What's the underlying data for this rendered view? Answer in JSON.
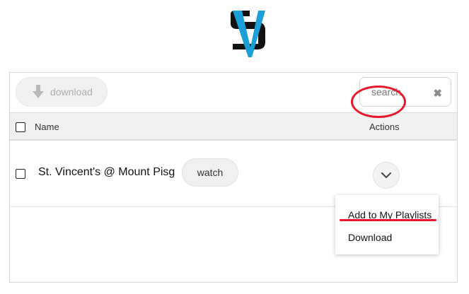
{
  "toolbar": {
    "download_label": "download",
    "search_placeholder": "search"
  },
  "table": {
    "headers": {
      "name": "Name",
      "actions": "Actions"
    },
    "rows": [
      {
        "name": "St. Vincent's @ Mount Pisg",
        "watch_label": "watch"
      }
    ]
  },
  "action_menu": {
    "items": [
      "Add to My Playlists",
      "Download"
    ]
  },
  "colors": {
    "annotation": "#e8182a",
    "logo_blue": "#1a9fd6",
    "logo_black": "#111111"
  },
  "icons": {
    "download": "download-arrow-icon",
    "clear": "close-icon",
    "actions": "chevron-down-icon"
  }
}
